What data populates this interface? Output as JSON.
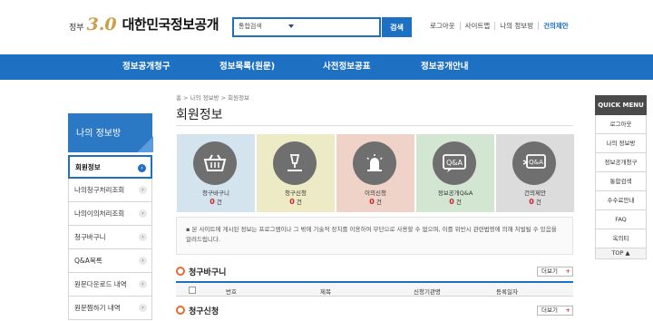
{
  "header": {
    "logo_prefix": "정부",
    "logo_version": "3.0",
    "logo_title": "대한민국정보공개",
    "search_select": "통합검색",
    "search_button": "검색",
    "util_links": [
      "로그아웃",
      "사이트맵",
      "나의 정보방",
      "건의제안"
    ]
  },
  "gnb": [
    "정보공개청구",
    "정보목록(원문)",
    "사전정보공표",
    "정보공개안내"
  ],
  "sidebar": {
    "title": "나의 정보방",
    "items": [
      "회원정보",
      "나의청구처리조회",
      "나의이의처리조회",
      "청구바구니",
      "Q&A목록",
      "원문다운로드 내역",
      "원문찜하기 내역"
    ],
    "arrow": "›"
  },
  "breadcrumb": "홈 > 나의 정보방 > 회원정보",
  "page_title": "회원정보",
  "cards": [
    {
      "label": "청구바구니",
      "count": "0",
      "unit": " 건",
      "color": "#d4e4ee",
      "icon": "basket-icon"
    },
    {
      "label": "청구신청",
      "count": "0",
      "unit": " 건",
      "color": "#ecebc6",
      "icon": "pen-icon"
    },
    {
      "label": "이의신청",
      "count": "0",
      "unit": " 건",
      "color": "#efd3c8",
      "icon": "siren-icon"
    },
    {
      "label": "정보공개Q&A",
      "count": "0",
      "unit": " 건",
      "color": "#d3e6d2",
      "icon": "qa-icon"
    },
    {
      "label": "건의제안",
      "count": "0",
      "unit": " 건",
      "color": "#dcdcdc",
      "icon": "qa-reply-icon"
    }
  ],
  "notice": "본 사이트에 게시된 정보는 프로그램이나 그 밖에 기술적 장치를 이용하여 무단으로 사용할 수 없으며, 이를 위반시 관련법령에 의해 처벌될 수 있음을 알려드립니다.",
  "sections": {
    "basket": {
      "title": "청구바구니",
      "more": "더보기",
      "plus": "+"
    },
    "request": {
      "title": "청구신청",
      "more": "더보기",
      "plus": "+"
    }
  },
  "table_headers": [
    "번호",
    "제목",
    "신청기관명",
    "등록일자"
  ],
  "quick_menu": {
    "title": "QUICK MENU",
    "items": [
      "로그아웃",
      "나의 정보방",
      "정보공개청구",
      "통합검색",
      "수수료안내",
      "FAQ",
      "옥의티"
    ],
    "top": "TOP ▲"
  },
  "colors": {
    "primary": "#1d70c2",
    "accent_red": "#d2232a",
    "icon_circle": "#6f6f6f"
  }
}
